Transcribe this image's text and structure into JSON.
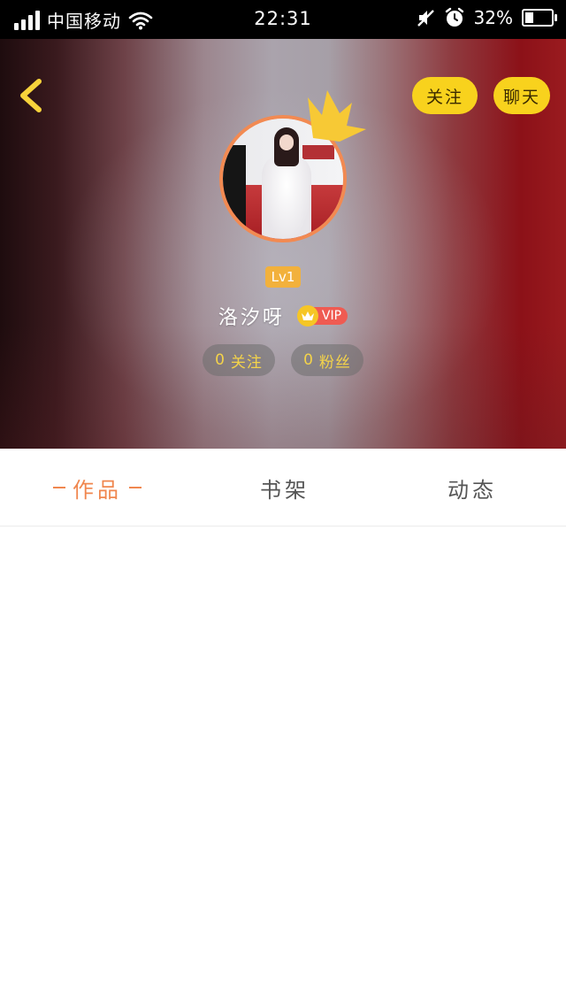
{
  "status_bar": {
    "carrier": "中国移动",
    "time": "22:31",
    "battery_percent": "32%",
    "battery_level": 0.32,
    "icons": [
      "signal-icon",
      "wifi-icon",
      "mute-icon",
      "alarm-icon",
      "battery-icon"
    ]
  },
  "header": {
    "back_icon": "chevron-left-icon",
    "follow_label": "关注",
    "chat_label": "聊天"
  },
  "profile": {
    "level": "Lv1",
    "username": "洛汐呀",
    "vip_label": "VIP",
    "following": {
      "count": "0",
      "label": "关注"
    },
    "fans": {
      "count": "0",
      "label": "粉丝"
    }
  },
  "tabs": [
    {
      "label": "作品",
      "active": true
    },
    {
      "label": "书架",
      "active": false
    },
    {
      "label": "动态",
      "active": false
    }
  ],
  "colors": {
    "accent_yellow": "#f8d21d",
    "active_tab": "#f0874f",
    "avatar_border": "#f28a52",
    "level_badge": "#f2b13c",
    "vip_red": "#ef5b52"
  }
}
